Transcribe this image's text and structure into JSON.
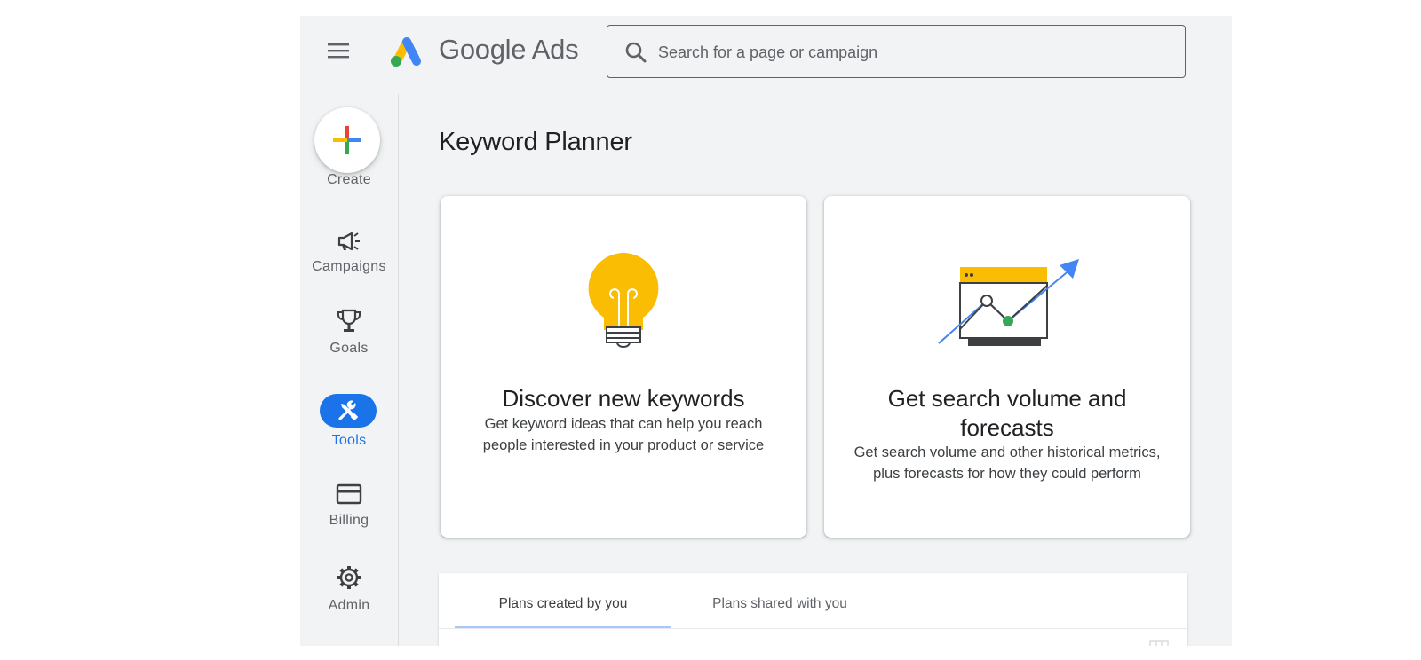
{
  "header": {
    "brand_google": "Google",
    "brand_ads": "Ads",
    "search_placeholder": "Search for a page or campaign"
  },
  "sidebar": {
    "items": [
      {
        "label": "Create",
        "icon": "plus-icon"
      },
      {
        "label": "Campaigns",
        "icon": "megaphone-icon"
      },
      {
        "label": "Goals",
        "icon": "trophy-icon"
      },
      {
        "label": "Tools",
        "icon": "tools-icon",
        "active": true
      },
      {
        "label": "Billing",
        "icon": "credit-card-icon"
      },
      {
        "label": "Admin",
        "icon": "gear-icon"
      }
    ]
  },
  "main": {
    "title": "Keyword Planner",
    "cards": [
      {
        "title": "Discover new keywords",
        "desc_line1": "Get keyword ideas that can help you reach",
        "desc_line2": "people interested in your product or service",
        "icon": "lightbulb-icon"
      },
      {
        "title_line1": "Get search volume and",
        "title_line2": "forecasts",
        "desc_line1": "Get search volume and other historical metrics,",
        "desc_line2": "plus forecasts for how they could perform",
        "icon": "forecast-chart-icon"
      }
    ],
    "plans_tabs": [
      {
        "label": "Plans created by you",
        "active": true
      },
      {
        "label": "Plans shared with you",
        "active": false
      }
    ]
  },
  "colors": {
    "accent": "#1a73e8",
    "google_blue": "#4285f4",
    "google_red": "#ea4335",
    "google_yellow": "#fbbc04",
    "google_green": "#34a853"
  }
}
